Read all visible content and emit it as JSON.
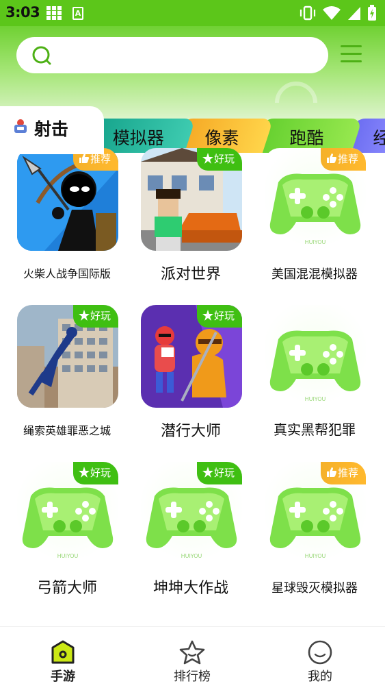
{
  "status_bar": {
    "time": "3:03"
  },
  "search": {
    "placeholder": ""
  },
  "category_tabs": [
    {
      "label": "射击",
      "active": true
    },
    {
      "label": "模拟器",
      "active": false
    },
    {
      "label": "像素",
      "active": false
    },
    {
      "label": "跑酷",
      "active": false
    },
    {
      "label": "经",
      "active": false
    }
  ],
  "games": [
    {
      "name": "火柴人战争国际版",
      "badge": "推荐",
      "badge_type": "rec",
      "thumb": "stickman-archer"
    },
    {
      "name": "派对世界",
      "badge": "好玩",
      "badge_type": "fun",
      "thumb": "party-world"
    },
    {
      "name": "美国混混模拟器",
      "badge": "推荐",
      "badge_type": "rec",
      "thumb": "gamepad"
    },
    {
      "name": "绳索英雄罪恶之城",
      "badge": "好玩",
      "badge_type": "fun",
      "thumb": "rope-hero"
    },
    {
      "name": "潜行大师",
      "badge": "好玩",
      "badge_type": "fun",
      "thumb": "stealth-master"
    },
    {
      "name": "真实黑帮犯罪",
      "badge": "",
      "badge_type": "",
      "thumb": "gamepad"
    },
    {
      "name": "弓箭大师",
      "badge": "好玩",
      "badge_type": "fun",
      "thumb": "gamepad"
    },
    {
      "name": "坤坤大作战",
      "badge": "好玩",
      "badge_type": "fun",
      "thumb": "gamepad"
    },
    {
      "name": "星球毁灭模拟器",
      "badge": "推荐",
      "badge_type": "rec",
      "thumb": "gamepad"
    }
  ],
  "bottom_nav": [
    {
      "label": "手游",
      "icon": "home-icon",
      "active": true
    },
    {
      "label": "排行榜",
      "icon": "star-icon",
      "active": false
    },
    {
      "label": "我的",
      "icon": "smile-icon",
      "active": false
    }
  ],
  "colors": {
    "primary": "#5cc61a",
    "badge_recommend": "#f5b12a",
    "badge_fun": "#3fbf12"
  }
}
